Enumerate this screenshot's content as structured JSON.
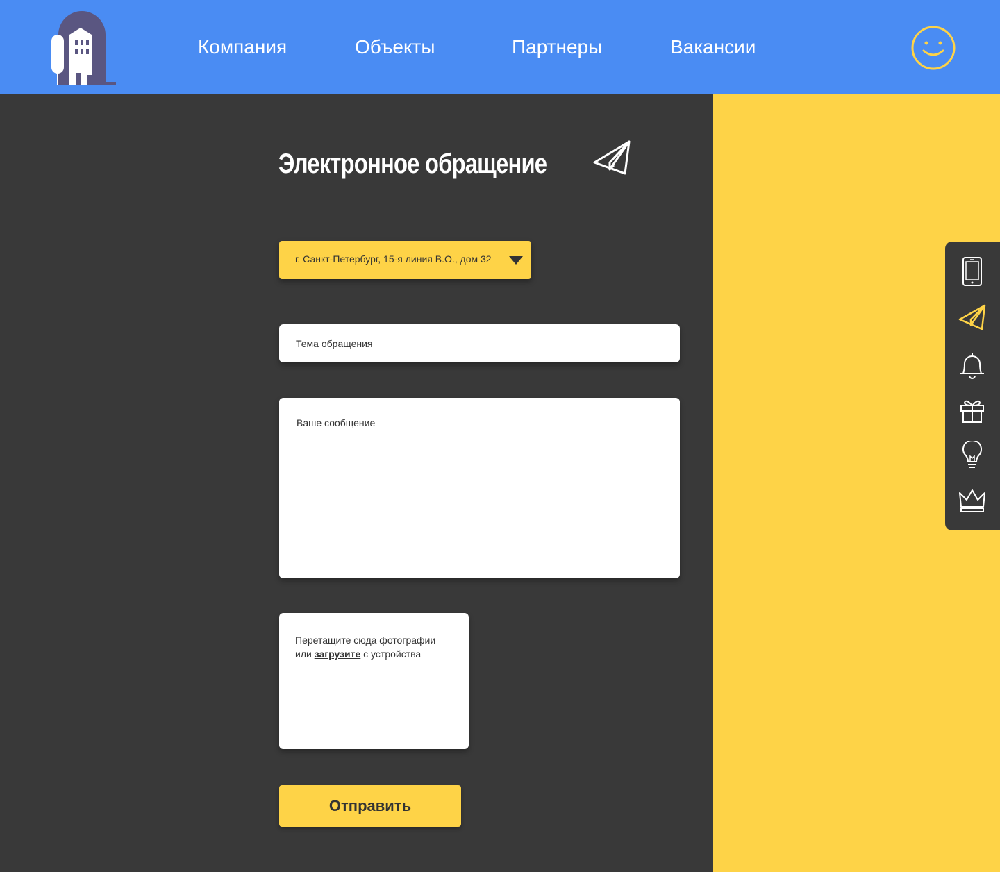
{
  "header": {
    "nav": [
      {
        "label": "Компания"
      },
      {
        "label": "Объекты"
      },
      {
        "label": "Партнеры"
      },
      {
        "label": "Вакансии"
      }
    ],
    "logo_icon": "building-logo-icon",
    "user_icon": "smiley-face-icon"
  },
  "form": {
    "title": "Электронное обращение",
    "title_icon": "paper-plane-icon",
    "address": {
      "selected": "г. Санкт-Петербург, 15-я линия В.О., дом 32"
    },
    "subject": {
      "placeholder": "Тема обращения"
    },
    "message": {
      "placeholder": "Ваше сообщение"
    },
    "upload": {
      "line1": "Перетащите сюда фотографии",
      "prefix": "или",
      "link": "загрузите",
      "suffix": "с устройства"
    },
    "submit_label": "Отправить"
  },
  "side_menu": {
    "items": [
      {
        "icon": "tablet-icon"
      },
      {
        "icon": "paper-plane-icon",
        "active": true
      },
      {
        "icon": "bell-icon"
      },
      {
        "icon": "gift-icon"
      },
      {
        "icon": "lightbulb-icon"
      },
      {
        "icon": "crown-icon"
      }
    ]
  },
  "colors": {
    "header_bg": "#4a8cf3",
    "main_bg": "#393939",
    "accent_yellow": "#fed347",
    "text_dark": "#333333",
    "logo_purple": "#5a5681"
  }
}
